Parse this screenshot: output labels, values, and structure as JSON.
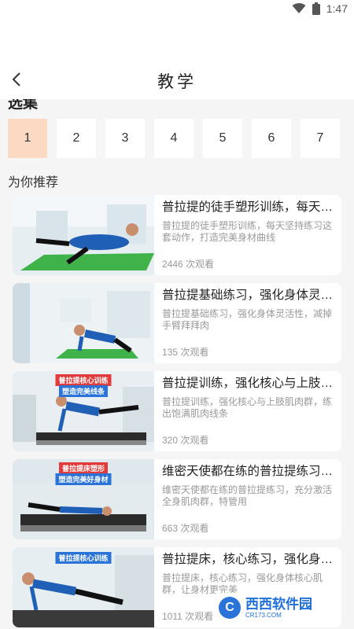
{
  "status_bar": {
    "time": "1:47"
  },
  "header": {
    "title": "教学"
  },
  "section": {
    "episodes_title": "选集",
    "recommend_title": "为你推荐"
  },
  "episodes": [
    "1",
    "2",
    "3",
    "4",
    "5",
    "6",
    "7"
  ],
  "active_episode": "1",
  "cards": [
    {
      "title": "普拉提的徒手塑形训练，每天…",
      "desc": "普拉提的徒手塑形训练，每天坚持练习这套动作，打造完美身材曲线",
      "views": "2446 次观看",
      "caption1": "",
      "caption2": ""
    },
    {
      "title": "普拉提基础练习，强化身体灵…",
      "desc": "普拉提基础练习，强化身体灵活性，减掉手臂拜拜肉",
      "views": "135 次观看",
      "caption1": "",
      "caption2": ""
    },
    {
      "title": "普拉提训练，强化核心与上肢…",
      "desc": "普拉提训练，强化核心与上肢肌肉群，练出饱满肌肉线条",
      "views": "320 次观看",
      "caption1": "普拉提核心训练",
      "caption2": "塑造完美线条"
    },
    {
      "title": "维密天使都在练的普拉提练习…",
      "desc": "维密天使都在练的普拉提练习，充分激活全身肌肉群，特管用",
      "views": "663 次观看",
      "caption1": "普拉提床塑形",
      "caption2": "塑造完美好身材"
    },
    {
      "title": "普拉提床，核心练习，强化身…",
      "desc": "普拉提床，核心练习，强化身体核心肌群，让身材更完美",
      "views": "1011 次观看",
      "caption1": "普拉提核心训练",
      "caption2": ""
    }
  ],
  "watermark": {
    "logo": "C",
    "name": "西西软件园",
    "site": "CR173.COM"
  },
  "colors": {
    "active_episode_bg": "#fbd9c3",
    "mat_green": "#3fb34a",
    "shirt_blue": "#1f5fb5"
  }
}
